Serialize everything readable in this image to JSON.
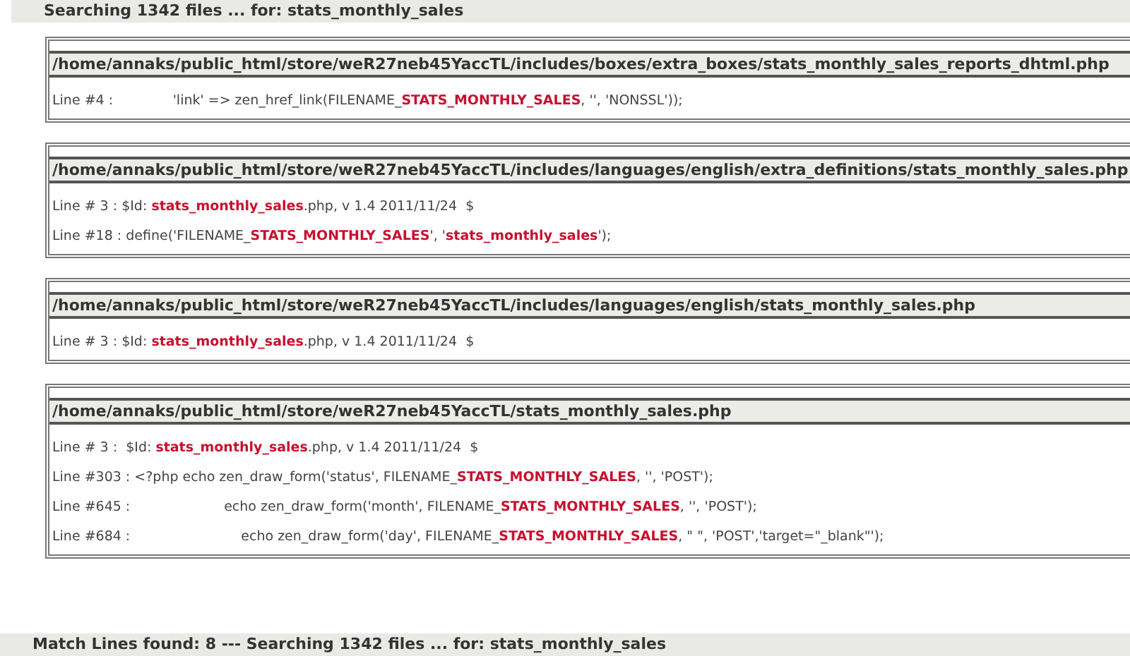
{
  "header": "Searching 1342 files ... for: stats_monthly_sales",
  "results": [
    {
      "path": "/home/annaks/public_html/store/weR27neb45YaccTL/includes/boxes/extra_boxes/stats_monthly_sales_reports_dhtml.php",
      "lines": [
        {
          "label": "Line #4 :",
          "code": "              'link' => zen_href_link(FILENAME_**STATS_MONTHLY_SALES**, '', 'NONSSL'));"
        }
      ]
    },
    {
      "path": "/home/annaks/public_html/store/weR27neb45YaccTL/includes/languages/english/extra_definitions/stats_monthly_sales.php",
      "lines": [
        {
          "label": "Line # 3 :",
          "code": " $Id: **stats_monthly_sales**.php, v 1.4 2011/11/24  $"
        },
        {
          "label": "Line #18 :",
          "code": " define('FILENAME_**STATS_MONTHLY_SALES**', '**stats_monthly_sales**');"
        }
      ]
    },
    {
      "path": "/home/annaks/public_html/store/weR27neb45YaccTL/includes/languages/english/stats_monthly_sales.php",
      "lines": [
        {
          "label": "Line # 3 :",
          "code": " $Id: **stats_monthly_sales**.php, v 1.4 2011/11/24  $"
        }
      ]
    },
    {
      "path": "/home/annaks/public_html/store/weR27neb45YaccTL/stats_monthly_sales.php",
      "lines": [
        {
          "label": "Line # 3 :",
          "code": "  $Id: **stats_monthly_sales**.php, v 1.4 2011/11/24  $"
        },
        {
          "label": "Line #303 :",
          "code": " <?php echo zen_draw_form('status', FILENAME_**STATS_MONTHLY_SALES**, '', 'POST');"
        },
        {
          "label": "Line #645 :",
          "code": "                      echo zen_draw_form('month', FILENAME_**STATS_MONTHLY_SALES**, '', 'POST');"
        },
        {
          "label": "Line #684 :",
          "code": "                          echo zen_draw_form('day', FILENAME_**STATS_MONTHLY_SALES**, \" \", 'POST','target=\"_blank\"');"
        }
      ]
    }
  ],
  "footer": "Match Lines found: 8 --- Searching 1342 files ... for: stats_monthly_sales"
}
